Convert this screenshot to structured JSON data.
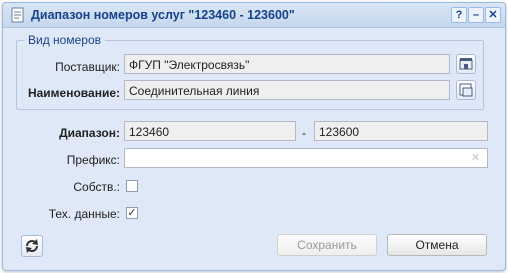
{
  "window": {
    "title": "Диапазон номеров услуг \"123460 - 123600\"",
    "tools": [
      "?",
      "–",
      "✕"
    ]
  },
  "fieldset": {
    "legend": "Вид номеров"
  },
  "supplier": {
    "label": "Поставщик:",
    "value": "ФГУП \"Электросвязь\""
  },
  "name": {
    "label": "Наименование:",
    "value": "Соединительная линия"
  },
  "range": {
    "label": "Диапазон:",
    "from": "123460",
    "separator": "-",
    "to": "123600"
  },
  "prefix": {
    "label": "Префикс:",
    "value": "",
    "clear_glyph": "✕"
  },
  "own": {
    "label": "Собств.:",
    "checked": false
  },
  "techdata": {
    "label": "Тех. данные:",
    "checked": true,
    "check_glyph": "✓"
  },
  "buttons": {
    "save": "Сохранить",
    "cancel": "Отмена",
    "save_disabled": true
  },
  "colors": {
    "title_text": "#15428b",
    "window_bg": "#dfe8f6",
    "border": "#99bbe8"
  }
}
